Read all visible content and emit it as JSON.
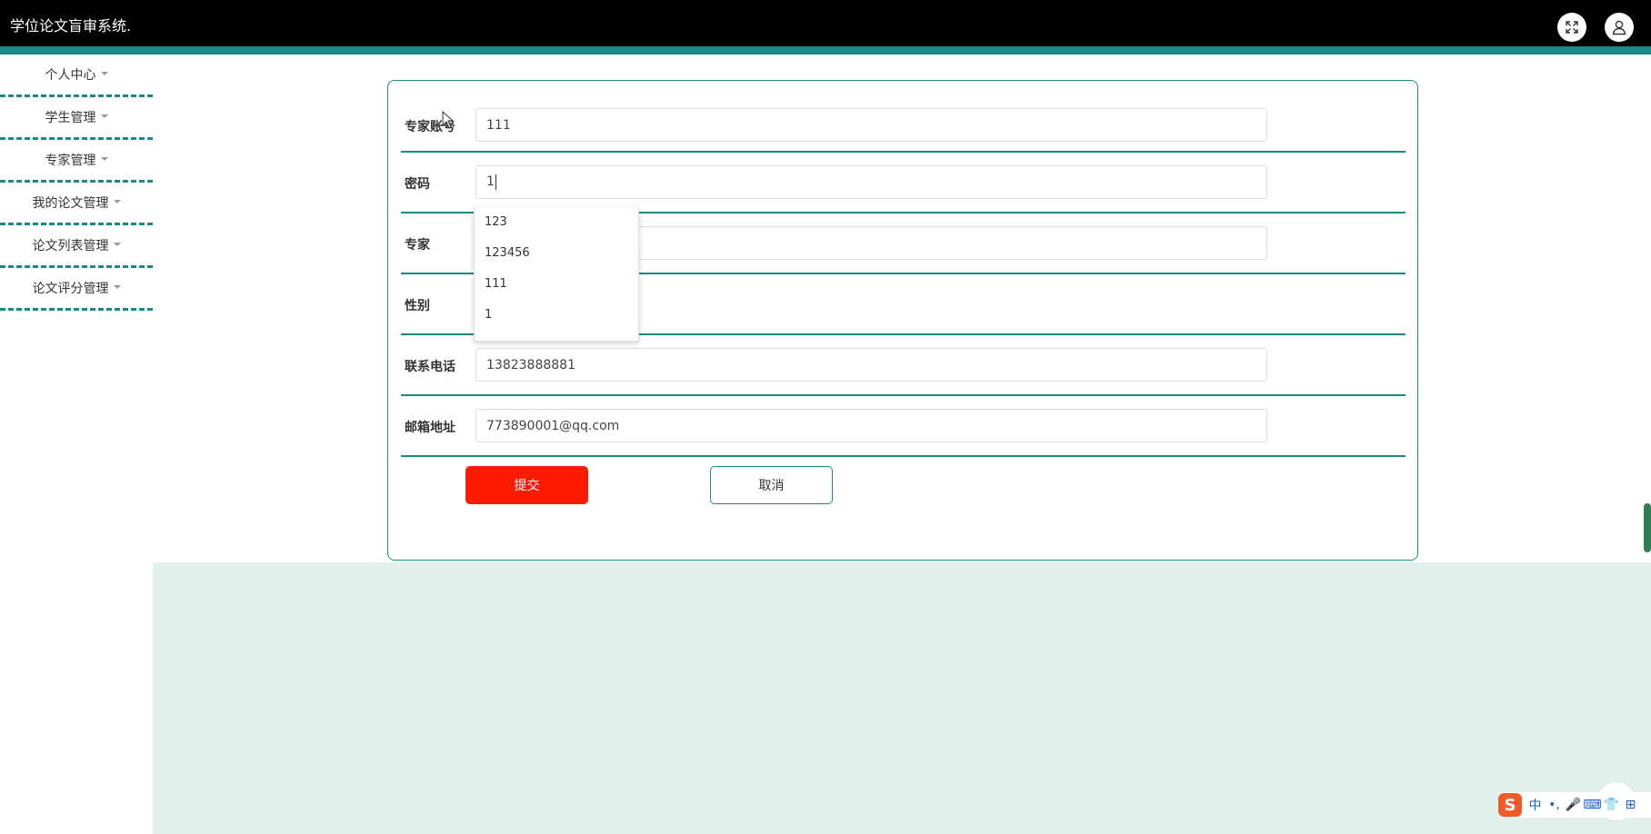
{
  "header": {
    "app_title": "学位论文盲审系统.",
    "fullscreen_icon": "fullscreen-icon",
    "user_icon": "user-icon"
  },
  "sidebar": {
    "items": [
      {
        "label": "个人中心"
      },
      {
        "label": "学生管理"
      },
      {
        "label": "专家管理"
      },
      {
        "label": "我的论文管理"
      },
      {
        "label": "论文列表管理"
      },
      {
        "label": "论文评分管理"
      }
    ]
  },
  "form": {
    "account": {
      "label": "专家账号",
      "value": "111"
    },
    "password": {
      "label": "密码",
      "value": "1"
    },
    "name": {
      "label": "专家",
      "value": ""
    },
    "gender": {
      "label": "性别",
      "value": ""
    },
    "phone": {
      "label": "联系电话",
      "value": "13823888881"
    },
    "email": {
      "label": "邮箱地址",
      "value": "773890001@qq.com"
    },
    "submit_label": "提交",
    "cancel_label": "取消"
  },
  "autocomplete": {
    "options": [
      "123",
      "123456",
      "111",
      "1"
    ]
  },
  "ime": {
    "logo": "S",
    "items": [
      "中",
      "•,",
      "🎤",
      "⌨",
      "👕",
      "⊞"
    ]
  },
  "colors": {
    "accent": "#1b8a86",
    "submit": "#ff1a00",
    "content_background": "#e2f0ec",
    "topbar": "#000000"
  }
}
